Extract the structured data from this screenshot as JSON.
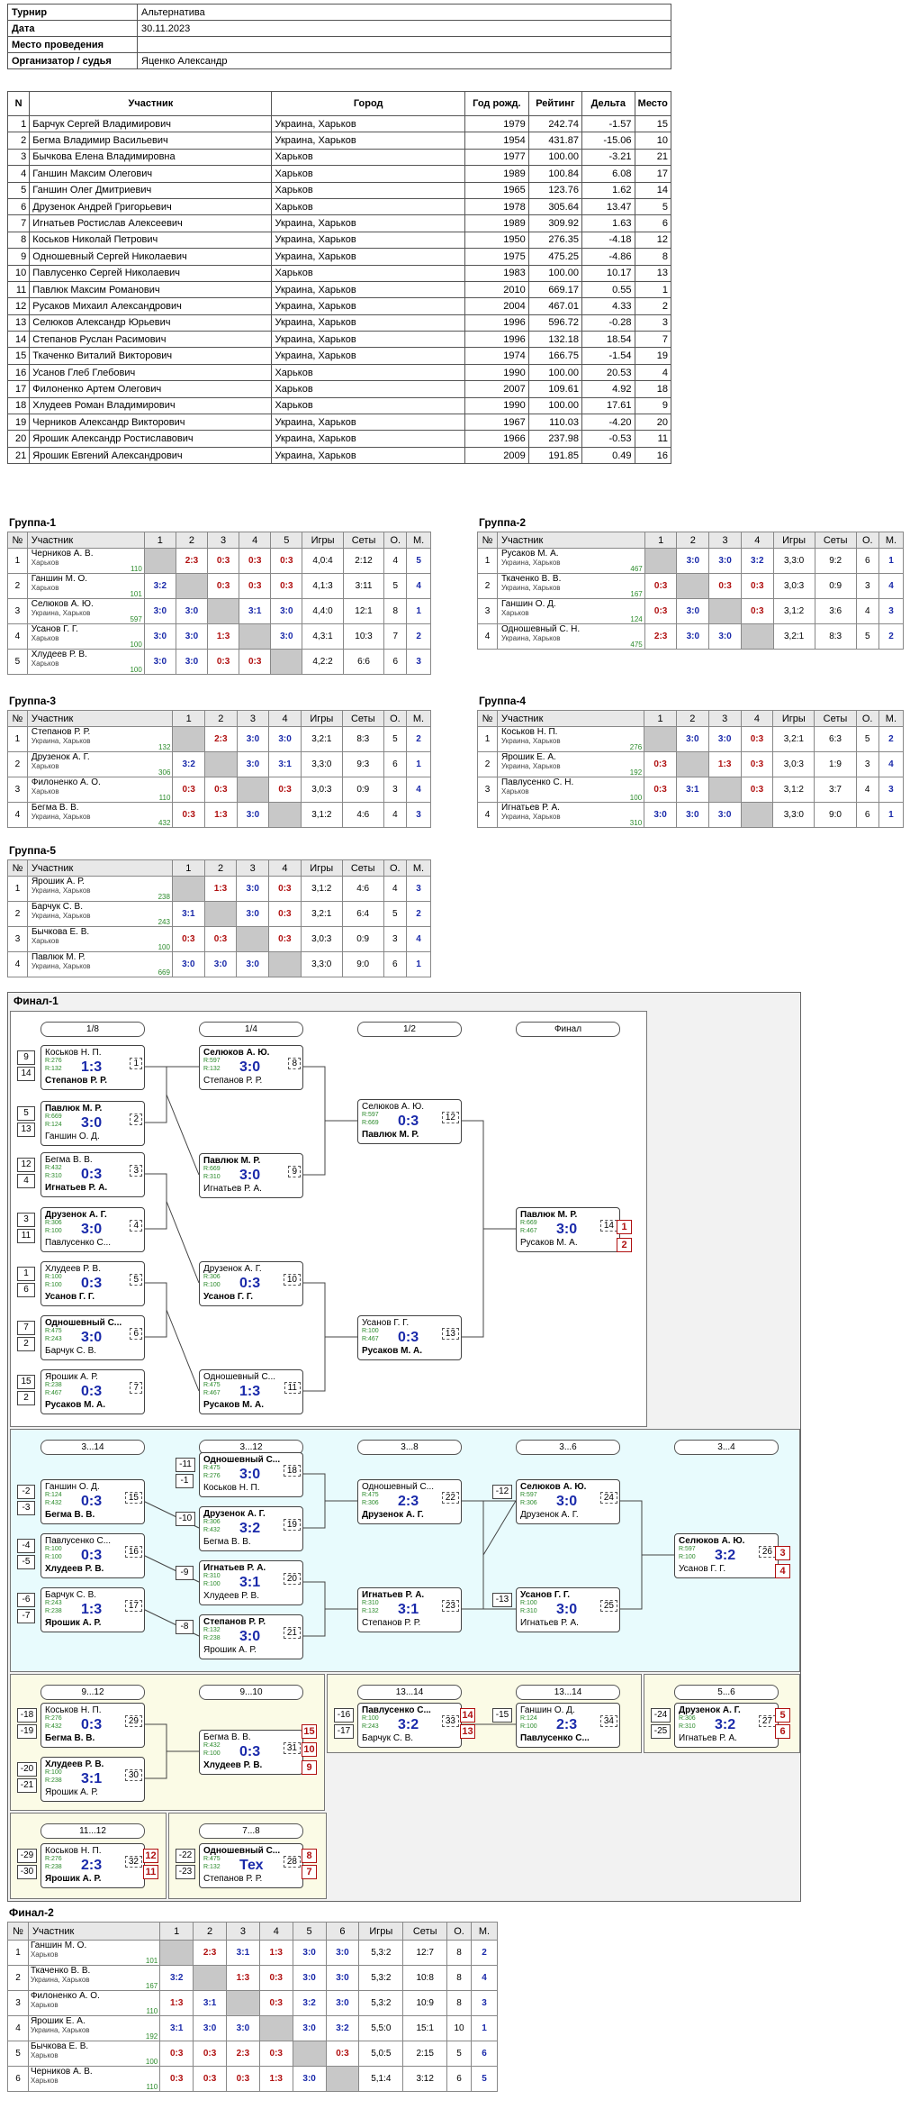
{
  "info": [
    {
      "k": "Турнир",
      "v": "Альтернатива"
    },
    {
      "k": "Дата",
      "v": "30.11.2023"
    },
    {
      "k": "Место проведения",
      "v": ""
    },
    {
      "k": "Организатор / судья",
      "v": "Яценко Александр"
    }
  ],
  "players_headers": [
    "N",
    "Участник",
    "Город",
    "Год рожд.",
    "Рейтинг",
    "Дельта",
    "Место"
  ],
  "players": [
    [
      "1",
      "Барчук Сергей Владимирович",
      "Украина, Харьков",
      "1979",
      "242.74",
      "-1.57",
      "15"
    ],
    [
      "2",
      "Бегма Владимир Васильевич",
      "Украина, Харьков",
      "1954",
      "431.87",
      "-15.06",
      "10"
    ],
    [
      "3",
      "Бычкова Елена Владимировна",
      "Харьков",
      "1977",
      "100.00",
      "-3.21",
      "21"
    ],
    [
      "4",
      "Ганшин Максим Олегович",
      "Харьков",
      "1989",
      "100.84",
      "6.08",
      "17"
    ],
    [
      "5",
      "Ганшин Олег Дмитриевич",
      "Харьков",
      "1965",
      "123.76",
      "1.62",
      "14"
    ],
    [
      "6",
      "Друзенок Андрей Григорьевич",
      "Харьков",
      "1978",
      "305.64",
      "13.47",
      "5"
    ],
    [
      "7",
      "Игнатьев Ростислав Алексеевич",
      "Украина, Харьков",
      "1989",
      "309.92",
      "1.63",
      "6"
    ],
    [
      "8",
      "Коськов Николай Петрович",
      "Украина, Харьков",
      "1950",
      "276.35",
      "-4.18",
      "12"
    ],
    [
      "9",
      "Одношевный Сергей Николаевич",
      "Украина, Харьков",
      "1975",
      "475.25",
      "-4.86",
      "8"
    ],
    [
      "10",
      "Павлусенко Сергей Николаевич",
      "Харьков",
      "1983",
      "100.00",
      "10.17",
      "13"
    ],
    [
      "11",
      "Павлюк Максим Романович",
      "Украина, Харьков",
      "2010",
      "669.17",
      "0.55",
      "1"
    ],
    [
      "12",
      "Русаков Михаил Александрович",
      "Украина, Харьков",
      "2004",
      "467.01",
      "4.33",
      "2"
    ],
    [
      "13",
      "Селюков Александр Юрьевич",
      "Украина, Харьков",
      "1996",
      "596.72",
      "-0.28",
      "3"
    ],
    [
      "14",
      "Степанов Руслан Расимович",
      "Украина, Харьков",
      "1996",
      "132.18",
      "18.54",
      "7"
    ],
    [
      "15",
      "Ткаченко Виталий Викторович",
      "Украина, Харьков",
      "1974",
      "166.75",
      "-1.54",
      "19"
    ],
    [
      "16",
      "Усанов Глеб Глебович",
      "Харьков",
      "1990",
      "100.00",
      "20.53",
      "4"
    ],
    [
      "17",
      "Филоненко Артем Олегович",
      "Харьков",
      "2007",
      "109.61",
      "4.92",
      "18"
    ],
    [
      "18",
      "Хлудеев Роман Владимирович",
      "Харьков",
      "1990",
      "100.00",
      "17.61",
      "9"
    ],
    [
      "19",
      "Черников Александр Викторович",
      "Украина, Харьков",
      "1967",
      "110.03",
      "-4.20",
      "20"
    ],
    [
      "20",
      "Ярошик Александр Ростиславович",
      "Украина, Харьков",
      "1966",
      "237.98",
      "-0.53",
      "11"
    ],
    [
      "21",
      "Ярошик Евгений Александрович",
      "Украина, Харьков",
      "2009",
      "191.85",
      "0.49",
      "16"
    ]
  ],
  "group_headers": {
    "num": "№",
    "name": "Участник",
    "games": "Игры",
    "sets": "Сеты",
    "points": "О.",
    "place": "М."
  },
  "groups": [
    {
      "title": "Группа-1",
      "players": [
        {
          "n": "1",
          "name": "Черников А. В.",
          "city": "Харьков",
          "rating": "110",
          "cells": [
            "",
            "2:3",
            "0:3",
            "0:3",
            "0:3"
          ],
          "games": "4,0:4",
          "sets": "2:12",
          "pts": "4",
          "place": "5"
        },
        {
          "n": "2",
          "name": "Ганшин М. О.",
          "city": "Харьков",
          "rating": "101",
          "cells": [
            "3:2",
            "",
            "0:3",
            "0:3",
            "0:3"
          ],
          "games": "4,1:3",
          "sets": "3:11",
          "pts": "5",
          "place": "4"
        },
        {
          "n": "3",
          "name": "Селюков А. Ю.",
          "city": "Украина, Харьков",
          "rating": "597",
          "cells": [
            "3:0",
            "3:0",
            "",
            "3:1",
            "3:0"
          ],
          "games": "4,4:0",
          "sets": "12:1",
          "pts": "8",
          "place": "1"
        },
        {
          "n": "4",
          "name": "Усанов Г. Г.",
          "city": "Харьков",
          "rating": "100",
          "cells": [
            "3:0",
            "3:0",
            "1:3",
            "",
            "3:0"
          ],
          "games": "4,3:1",
          "sets": "10:3",
          "pts": "7",
          "place": "2"
        },
        {
          "n": "5",
          "name": "Хлудеев Р. В.",
          "city": "Харьков",
          "rating": "100",
          "cells": [
            "3:0",
            "3:0",
            "0:3",
            "0:3",
            ""
          ],
          "games": "4,2:2",
          "sets": "6:6",
          "pts": "6",
          "place": "3"
        }
      ]
    },
    {
      "title": "Группа-2",
      "players": [
        {
          "n": "1",
          "name": "Русаков М. А.",
          "city": "Украина, Харьков",
          "rating": "467",
          "cells": [
            "",
            "3:0",
            "3:0",
            "3:2"
          ],
          "games": "3,3:0",
          "sets": "9:2",
          "pts": "6",
          "place": "1"
        },
        {
          "n": "2",
          "name": "Ткаченко В. В.",
          "city": "Украина, Харьков",
          "rating": "167",
          "cells": [
            "0:3",
            "",
            "0:3",
            "0:3"
          ],
          "games": "3,0:3",
          "sets": "0:9",
          "pts": "3",
          "place": "4"
        },
        {
          "n": "3",
          "name": "Ганшин О. Д.",
          "city": "Харьков",
          "rating": "124",
          "cells": [
            "0:3",
            "3:0",
            "",
            "0:3"
          ],
          "games": "3,1:2",
          "sets": "3:6",
          "pts": "4",
          "place": "3"
        },
        {
          "n": "4",
          "name": "Одношевный С. Н.",
          "city": "Украина, Харьков",
          "rating": "475",
          "cells": [
            "2:3",
            "3:0",
            "3:0",
            ""
          ],
          "games": "3,2:1",
          "sets": "8:3",
          "pts": "5",
          "place": "2"
        }
      ]
    },
    {
      "title": "Группа-3",
      "players": [
        {
          "n": "1",
          "name": "Степанов Р. Р.",
          "city": "Украина, Харьков",
          "rating": "132",
          "cells": [
            "",
            "2:3",
            "3:0",
            "3:0"
          ],
          "games": "3,2:1",
          "sets": "8:3",
          "pts": "5",
          "place": "2"
        },
        {
          "n": "2",
          "name": "Друзенок А. Г.",
          "city": "Харьков",
          "rating": "306",
          "cells": [
            "3:2",
            "",
            "3:0",
            "3:1"
          ],
          "games": "3,3:0",
          "sets": "9:3",
          "pts": "6",
          "place": "1"
        },
        {
          "n": "3",
          "name": "Филоненко А. О.",
          "city": "Харьков",
          "rating": "110",
          "cells": [
            "0:3",
            "0:3",
            "",
            "0:3"
          ],
          "games": "3,0:3",
          "sets": "0:9",
          "pts": "3",
          "place": "4"
        },
        {
          "n": "4",
          "name": "Бегма В. В.",
          "city": "Украина, Харьков",
          "rating": "432",
          "cells": [
            "0:3",
            "1:3",
            "3:0",
            ""
          ],
          "games": "3,1:2",
          "sets": "4:6",
          "pts": "4",
          "place": "3"
        }
      ]
    },
    {
      "title": "Группа-4",
      "players": [
        {
          "n": "1",
          "name": "Коськов Н. П.",
          "city": "Украина, Харьков",
          "rating": "276",
          "cells": [
            "",
            "3:0",
            "3:0",
            "0:3"
          ],
          "games": "3,2:1",
          "sets": "6:3",
          "pts": "5",
          "place": "2"
        },
        {
          "n": "2",
          "name": "Ярошик Е. А.",
          "city": "Украина, Харьков",
          "rating": "192",
          "cells": [
            "0:3",
            "",
            "1:3",
            "0:3"
          ],
          "games": "3,0:3",
          "sets": "1:9",
          "pts": "3",
          "place": "4"
        },
        {
          "n": "3",
          "name": "Павлусенко С. Н.",
          "city": "Харьков",
          "rating": "100",
          "cells": [
            "0:3",
            "3:1",
            "",
            "0:3"
          ],
          "games": "3,1:2",
          "sets": "3:7",
          "pts": "4",
          "place": "3"
        },
        {
          "n": "4",
          "name": "Игнатьев Р. А.",
          "city": "Украина, Харьков",
          "rating": "310",
          "cells": [
            "3:0",
            "3:0",
            "3:0",
            ""
          ],
          "games": "3,3:0",
          "sets": "9:0",
          "pts": "6",
          "place": "1"
        }
      ]
    },
    {
      "title": "Группа-5",
      "players": [
        {
          "n": "1",
          "name": "Ярошик А. Р.",
          "city": "Украина, Харьков",
          "rating": "238",
          "cells": [
            "",
            "1:3",
            "3:0",
            "0:3"
          ],
          "games": "3,1:2",
          "sets": "4:6",
          "pts": "4",
          "place": "3"
        },
        {
          "n": "2",
          "name": "Барчук С. В.",
          "city": "Украина, Харьков",
          "rating": "243",
          "cells": [
            "3:1",
            "",
            "3:0",
            "0:3"
          ],
          "games": "3,2:1",
          "sets": "6:4",
          "pts": "5",
          "place": "2"
        },
        {
          "n": "3",
          "name": "Бычкова Е. В.",
          "city": "Харьков",
          "rating": "100",
          "cells": [
            "0:3",
            "0:3",
            "",
            "0:3"
          ],
          "games": "3,0:3",
          "sets": "0:9",
          "pts": "3",
          "place": "4"
        },
        {
          "n": "4",
          "name": "Павлюк М. Р.",
          "city": "Украина, Харьков",
          "rating": "669",
          "cells": [
            "3:0",
            "3:0",
            "3:0",
            ""
          ],
          "games": "3,3:0",
          "sets": "9:0",
          "pts": "6",
          "place": "1"
        }
      ]
    }
  ],
  "final1": {
    "title": "Финал-1",
    "rounds": [
      "1/8",
      "1/4",
      "1/2",
      "Финал"
    ],
    "consolation_rounds": [
      "3...14",
      "3...12",
      "3...8",
      "3...6",
      "3...4"
    ],
    "lower_rounds": [
      "9...12",
      "9...10",
      "13...14",
      "13...14",
      "5...6",
      "11...12",
      "7...8"
    ],
    "matches": [
      {
        "id": "1",
        "p1": "Коськов Н. П.",
        "r1": "R:276",
        "p2": "Степанов Р. Р.",
        "r2": "R:132",
        "score": "1:3",
        "win": 2
      },
      {
        "id": "2",
        "p1": "Павлюк М. Р.",
        "r1": "R:669",
        "p2": "Ганшин О. Д.",
        "r2": "R:124",
        "score": "3:0",
        "win": 1
      },
      {
        "id": "3",
        "p1": "Бегма В. В.",
        "r1": "R:432",
        "p2": "Игнатьев Р. А.",
        "r2": "R:310",
        "score": "0:3",
        "win": 2
      },
      {
        "id": "4",
        "p1": "Друзенок А. Г.",
        "r1": "R:306",
        "p2": "Павлусенко С...",
        "r2": "R:100",
        "score": "3:0",
        "win": 1
      },
      {
        "id": "5",
        "p1": "Хлудеев Р. В.",
        "r1": "R:100",
        "p2": "Усанов Г. Г.",
        "r2": "R:100",
        "score": "0:3",
        "win": 2
      },
      {
        "id": "6",
        "p1": "Одношевный С...",
        "r1": "R:475",
        "p2": "Барчук С. В.",
        "r2": "R:243",
        "score": "3:0",
        "win": 1
      },
      {
        "id": "7",
        "p1": "Ярошик А. Р.",
        "r1": "R:238",
        "p2": "Русаков М. А.",
        "r2": "R:467",
        "score": "0:3",
        "win": 2
      },
      {
        "id": "8",
        "p1": "Селюков А. Ю.",
        "r1": "R:597",
        "p2": "Степанов Р. Р.",
        "r2": "R:132",
        "score": "3:0",
        "win": 1
      },
      {
        "id": "9",
        "p1": "Павлюк М. Р.",
        "r1": "R:669",
        "p2": "Игнатьев Р. А.",
        "r2": "R:310",
        "score": "3:0",
        "win": 1
      },
      {
        "id": "10",
        "p1": "Друзенок А. Г.",
        "r1": "R:306",
        "p2": "Усанов Г. Г.",
        "r2": "R:100",
        "score": "0:3",
        "win": 2
      },
      {
        "id": "11",
        "p1": "Одношевный С...",
        "r1": "R:475",
        "p2": "Русаков М. А.",
        "r2": "R:467",
        "score": "1:3",
        "win": 2
      },
      {
        "id": "12",
        "p1": "Селюков А. Ю.",
        "r1": "R:597",
        "p2": "Павлюк М. Р.",
        "r2": "R:669",
        "score": "0:3",
        "win": 2
      },
      {
        "id": "13",
        "p1": "Усанов Г. Г.",
        "r1": "R:100",
        "p2": "Русаков М. А.",
        "r2": "R:467",
        "score": "0:3",
        "win": 2
      },
      {
        "id": "14",
        "p1": "Павлюк М. Р.",
        "r1": "R:669",
        "p2": "Русаков М. А.",
        "r2": "R:467",
        "score": "3:0",
        "win": 1
      },
      {
        "id": "15",
        "p1": "Ганшин О. Д.",
        "r1": "R:124",
        "p2": "Бегма В. В.",
        "r2": "R:432",
        "score": "0:3",
        "win": 2
      },
      {
        "id": "16",
        "p1": "Павлусенко С...",
        "r1": "R:100",
        "p2": "Хлудеев Р. В.",
        "r2": "R:100",
        "score": "0:3",
        "win": 2
      },
      {
        "id": "17",
        "p1": "Барчук С. В.",
        "r1": "R:243",
        "p2": "Ярошик А. Р.",
        "r2": "R:238",
        "score": "1:3",
        "win": 2
      },
      {
        "id": "18",
        "p1": "Одношевный С...",
        "r1": "R:475",
        "p2": "Коськов Н. П.",
        "r2": "R:276",
        "score": "3:0",
        "win": 1
      },
      {
        "id": "19",
        "p1": "Друзенок А. Г.",
        "r1": "R:306",
        "p2": "Бегма В. В.",
        "r2": "R:432",
        "score": "3:2",
        "win": 1
      },
      {
        "id": "20",
        "p1": "Игнатьев Р. А.",
        "r1": "R:310",
        "p2": "Хлудеев Р. В.",
        "r2": "R:100",
        "score": "3:1",
        "win": 1
      },
      {
        "id": "21",
        "p1": "Степанов Р. Р.",
        "r1": "R:132",
        "p2": "Ярошик А. Р.",
        "r2": "R:238",
        "score": "3:0",
        "win": 1
      },
      {
        "id": "22",
        "p1": "Одношевный С...",
        "r1": "R:475",
        "p2": "Друзенок А. Г.",
        "r2": "R:306",
        "score": "2:3",
        "win": 2
      },
      {
        "id": "23",
        "p1": "Игнатьев Р. А.",
        "r1": "R:310",
        "p2": "Степанов Р. Р.",
        "r2": "R:132",
        "score": "3:1",
        "win": 1
      },
      {
        "id": "24",
        "p1": "Селюков А. Ю.",
        "r1": "R:597",
        "p2": "Друзенок А. Г.",
        "r2": "R:306",
        "score": "3:0",
        "win": 1
      },
      {
        "id": "25",
        "p1": "Усанов Г. Г.",
        "r1": "R:100",
        "p2": "Игнатьев Р. А.",
        "r2": "R:310",
        "score": "3:0",
        "win": 1
      },
      {
        "id": "26",
        "p1": "Селюков А. Ю.",
        "r1": "R:597",
        "p2": "Усанов Г. Г.",
        "r2": "R:100",
        "score": "3:2",
        "win": 1
      },
      {
        "id": "27",
        "p1": "Друзенок А. Г.",
        "r1": "R:306",
        "p2": "Игнатьев Р. А.",
        "r2": "R:310",
        "score": "3:2",
        "win": 1
      },
      {
        "id": "28",
        "p1": "Одношевный С...",
        "r1": "R:475",
        "p2": "Степанов Р. Р.",
        "r2": "R:132",
        "score": "Тех",
        "win": 1
      },
      {
        "id": "29",
        "p1": "Коськов Н. П.",
        "r1": "R:276",
        "p2": "Бегма В. В.",
        "r2": "R:432",
        "score": "0:3",
        "win": 2
      },
      {
        "id": "30",
        "p1": "Хлудеев Р. В.",
        "r1": "R:100",
        "p2": "Ярошик А. Р.",
        "r2": "R:238",
        "score": "3:1",
        "win": 1
      },
      {
        "id": "31",
        "p1": "Бегма В. В.",
        "r1": "R:432",
        "p2": "Хлудеев Р. В.",
        "r2": "R:100",
        "score": "0:3",
        "win": 2
      },
      {
        "id": "32",
        "p1": "Коськов Н. П.",
        "r1": "R:276",
        "p2": "Ярошик А. Р.",
        "r2": "R:238",
        "score": "2:3",
        "win": 2
      },
      {
        "id": "33",
        "p1": "Павлусенко С...",
        "r1": "R:100",
        "p2": "Барчук С. В.",
        "r2": "R:243",
        "score": "3:2",
        "win": 1
      },
      {
        "id": "34",
        "p1": "Ганшин О. Д.",
        "r1": "R:124",
        "p2": "Павлусенко С...",
        "r2": "R:100",
        "score": "2:3",
        "win": 2
      }
    ]
  },
  "final2": {
    "title": "Финал-2",
    "players": [
      {
        "n": "1",
        "name": "Ганшин М. О.",
        "city": "Харьков",
        "rating": "101",
        "cells": [
          "",
          "2:3",
          "3:1",
          "1:3",
          "3:0",
          "3:0"
        ],
        "games": "5,3:2",
        "sets": "12:7",
        "pts": "8",
        "place": "2"
      },
      {
        "n": "2",
        "name": "Ткаченко В. В.",
        "city": "Украина, Харьков",
        "rating": "167",
        "cells": [
          "3:2",
          "",
          "1:3",
          "0:3",
          "3:0",
          "3:0"
        ],
        "games": "5,3:2",
        "sets": "10:8",
        "pts": "8",
        "place": "4"
      },
      {
        "n": "3",
        "name": "Филоненко А. О.",
        "city": "Харьков",
        "rating": "110",
        "cells": [
          "1:3",
          "3:1",
          "",
          "0:3",
          "3:2",
          "3:0"
        ],
        "games": "5,3:2",
        "sets": "10:9",
        "pts": "8",
        "place": "3"
      },
      {
        "n": "4",
        "name": "Ярошик Е. А.",
        "city": "Украина, Харьков",
        "rating": "192",
        "cells": [
          "3:1",
          "3:0",
          "3:0",
          "",
          "3:0",
          "3:2"
        ],
        "games": "5,5:0",
        "sets": "15:1",
        "pts": "10",
        "place": "1"
      },
      {
        "n": "5",
        "name": "Бычкова Е. В.",
        "city": "Харьков",
        "rating": "100",
        "cells": [
          "0:3",
          "0:3",
          "2:3",
          "0:3",
          "",
          "0:3"
        ],
        "games": "5,0:5",
        "sets": "2:15",
        "pts": "5",
        "place": "6"
      },
      {
        "n": "6",
        "name": "Черников А. В.",
        "city": "Харьков",
        "rating": "110",
        "cells": [
          "0:3",
          "0:3",
          "0:3",
          "1:3",
          "3:0",
          ""
        ],
        "games": "5,1:4",
        "sets": "3:12",
        "pts": "6",
        "place": "5"
      }
    ]
  }
}
